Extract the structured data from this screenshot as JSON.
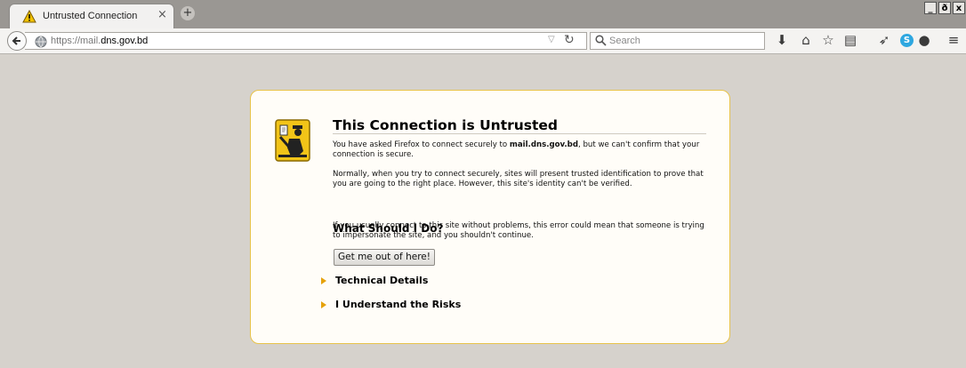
{
  "tab": {
    "title": "Untrusted Connection",
    "close": "×",
    "newtab": "+"
  },
  "window": {
    "minimize": "_",
    "maximize": "ð",
    "close": "x"
  },
  "navbar": {
    "url_prefix": "https://mail.",
    "url_domain": "dns.gov.bd",
    "search_placeholder": "Search"
  },
  "page": {
    "title": "This Connection is Untrusted",
    "p1_a": "You have asked Firefox to connect securely to ",
    "p1_host": "mail.dns.gov.bd",
    "p1_b": ", but we can't confirm that your connection is secure.",
    "p2": "Normally, when you try to connect securely, sites will present trusted identification to prove that you are going to the right place. However, this site's identity can't be verified.",
    "subtitle": "What Should I Do?",
    "p3": "If you usually connect to this site without problems, this error could mean that someone is trying to impersonate the site, and you shouldn't continue.",
    "button": "Get me out of here!",
    "technical": "Technical Details",
    "risks": "I Understand the Risks"
  },
  "colors": {
    "accent": "#e8c34a",
    "expander": "#e6a20b",
    "skype": "#2ea7e0"
  }
}
